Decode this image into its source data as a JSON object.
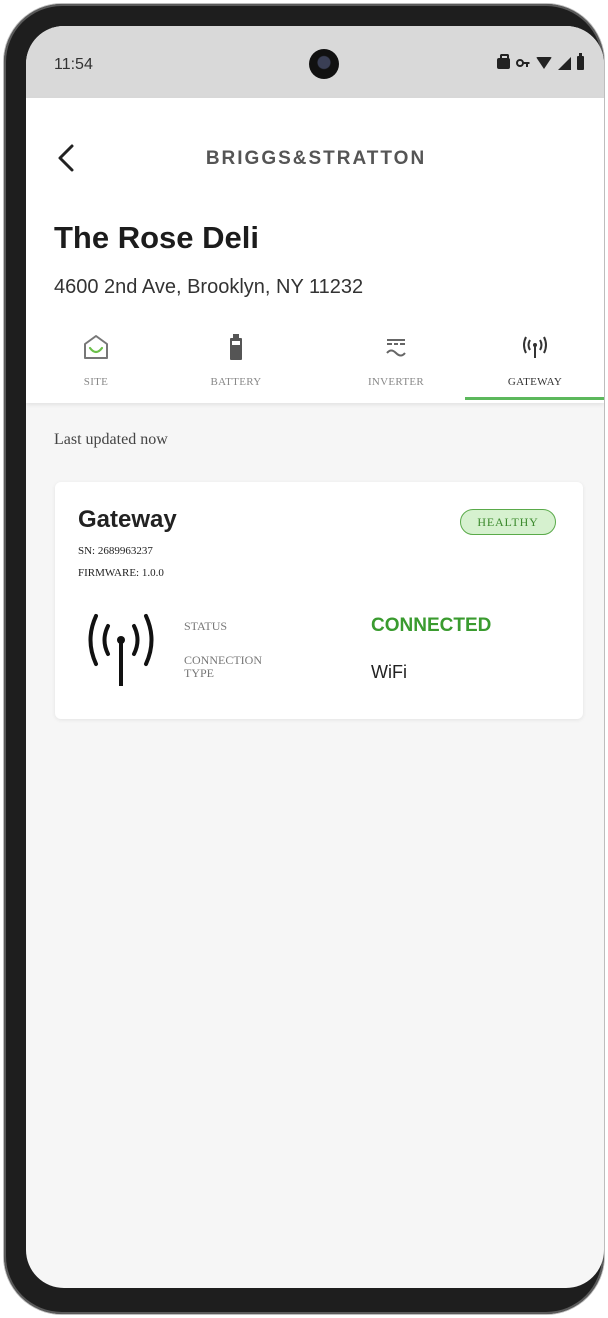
{
  "status_bar": {
    "time": "11:54",
    "icons": [
      "briefcase-icon",
      "vpn-key-icon",
      "wifi-icon",
      "cell-signal-icon",
      "battery-icon"
    ]
  },
  "header": {
    "brand": "BRIGGS&STRATTON",
    "site_name": "The Rose Deli",
    "address": "4600 2nd Ave, Brooklyn, NY 11232"
  },
  "tabs": [
    {
      "label": "SITE",
      "icon": "home-icon",
      "active": false
    },
    {
      "label": "BATTERY",
      "icon": "battery-icon",
      "active": false
    },
    {
      "label": "INVERTER",
      "icon": "inverter-icon",
      "active": false
    },
    {
      "label": "GATEWAY",
      "icon": "antenna-icon",
      "active": true
    }
  ],
  "last_updated": "Last updated now",
  "gateway_card": {
    "title": "Gateway",
    "badge": "HEALTHY",
    "sn": "SN: 2689963237",
    "firmware": "FIRMWARE: 1.0.0",
    "status_label": "STATUS",
    "status_value": "CONNECTED",
    "connection_type_label": "CONNECTION TYPE",
    "connection_type_value": "WiFi"
  },
  "colors": {
    "accent_green": "#5cb85c",
    "status_green": "#3a9b2f",
    "badge_bg": "#d6f1cf"
  }
}
